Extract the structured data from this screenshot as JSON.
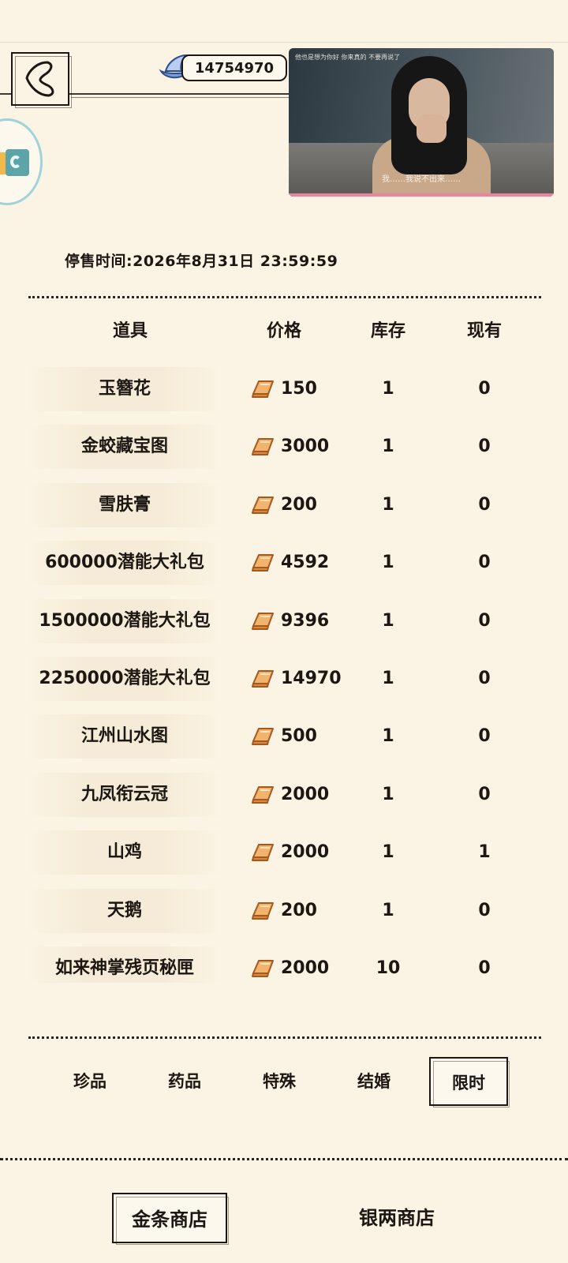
{
  "header": {
    "currency_amount": "14754970",
    "icons": {
      "back": "back-arrow-icon",
      "currency": "silver-ingot-icon",
      "side": "app-badge-icon"
    }
  },
  "video": {
    "subtitle": "我……我说不出来……",
    "caption": "他也是想为你好 你来真的 不要再说了"
  },
  "sale": {
    "label": "停售时间:",
    "datetime": "2026年8月31日   23:59:59"
  },
  "table": {
    "headers": {
      "item": "道具",
      "price": "价格",
      "stock": "库存",
      "owned": "现有"
    },
    "rows": [
      {
        "name": "玉簪花",
        "price": "150",
        "stock": "1",
        "owned": "0"
      },
      {
        "name": "金蛟藏宝图",
        "price": "3000",
        "stock": "1",
        "owned": "0"
      },
      {
        "name": "雪肤膏",
        "price": "200",
        "stock": "1",
        "owned": "0"
      },
      {
        "name": "600000潜能大礼包",
        "price": "4592",
        "stock": "1",
        "owned": "0"
      },
      {
        "name": "1500000潜能大礼包",
        "price": "9396",
        "stock": "1",
        "owned": "0"
      },
      {
        "name": "2250000潜能大礼包",
        "price": "14970",
        "stock": "1",
        "owned": "0"
      },
      {
        "name": "江州山水图",
        "price": "500",
        "stock": "1",
        "owned": "0"
      },
      {
        "name": "九凤衔云冠",
        "price": "2000",
        "stock": "1",
        "owned": "0"
      },
      {
        "name": "山鸡",
        "price": "2000",
        "stock": "1",
        "owned": "1"
      },
      {
        "name": "天鹅",
        "price": "200",
        "stock": "1",
        "owned": "0"
      },
      {
        "name": "如来神掌残页秘匣",
        "price": "2000",
        "stock": "10",
        "owned": "0"
      }
    ]
  },
  "tabs": [
    {
      "label": "珍品",
      "active": false
    },
    {
      "label": "药品",
      "active": false
    },
    {
      "label": "特殊",
      "active": false
    },
    {
      "label": "结婚",
      "active": false
    },
    {
      "label": "限时",
      "active": true
    }
  ],
  "shops": [
    {
      "label": "金条商店",
      "active": true
    },
    {
      "label": "银两商店",
      "active": false
    }
  ],
  "colors": {
    "background": "#fbf3e3",
    "ink": "#1c1712",
    "gold": "#e59a4e",
    "accent_pink": "#e9849e"
  }
}
